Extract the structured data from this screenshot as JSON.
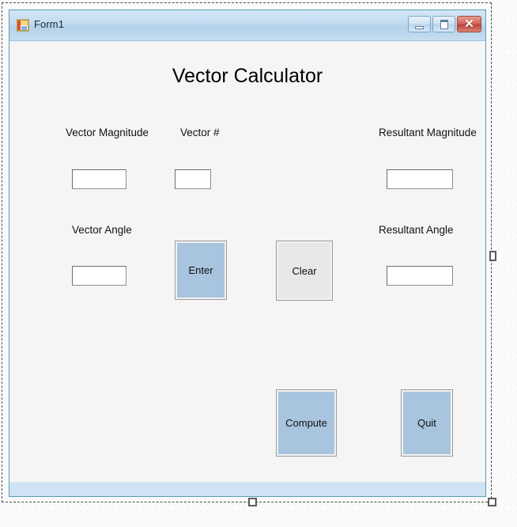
{
  "window": {
    "title": "Form1",
    "icon": "vb-form-icon",
    "controls": {
      "minimize_label": "–",
      "maximize_label": "□",
      "close_label": "✕"
    }
  },
  "form": {
    "heading": "Vector Calculator",
    "labels": {
      "vector_magnitude": "Vector Magnitude",
      "vector_number": "Vector #",
      "resultant_magnitude": "Resultant Magnitude",
      "vector_angle": "Vector Angle",
      "resultant_angle": "Resultant Angle"
    },
    "inputs": {
      "vector_magnitude": {
        "value": "",
        "placeholder": ""
      },
      "vector_number": {
        "value": "",
        "placeholder": ""
      },
      "resultant_magnitude": {
        "value": "",
        "placeholder": ""
      },
      "vector_angle": {
        "value": "",
        "placeholder": ""
      },
      "resultant_angle": {
        "value": "",
        "placeholder": ""
      }
    },
    "buttons": {
      "enter": "Enter",
      "clear": "Clear",
      "compute": "Compute",
      "quit": "Quit"
    }
  },
  "colors": {
    "button_blue": "#a8c4de",
    "button_grey": "#e8e8e8",
    "titlebar_blue": "#c2dbf0",
    "form_background": "#f5f5f5",
    "close_red": "#bc4438",
    "form_border": "#5a9cb5"
  }
}
